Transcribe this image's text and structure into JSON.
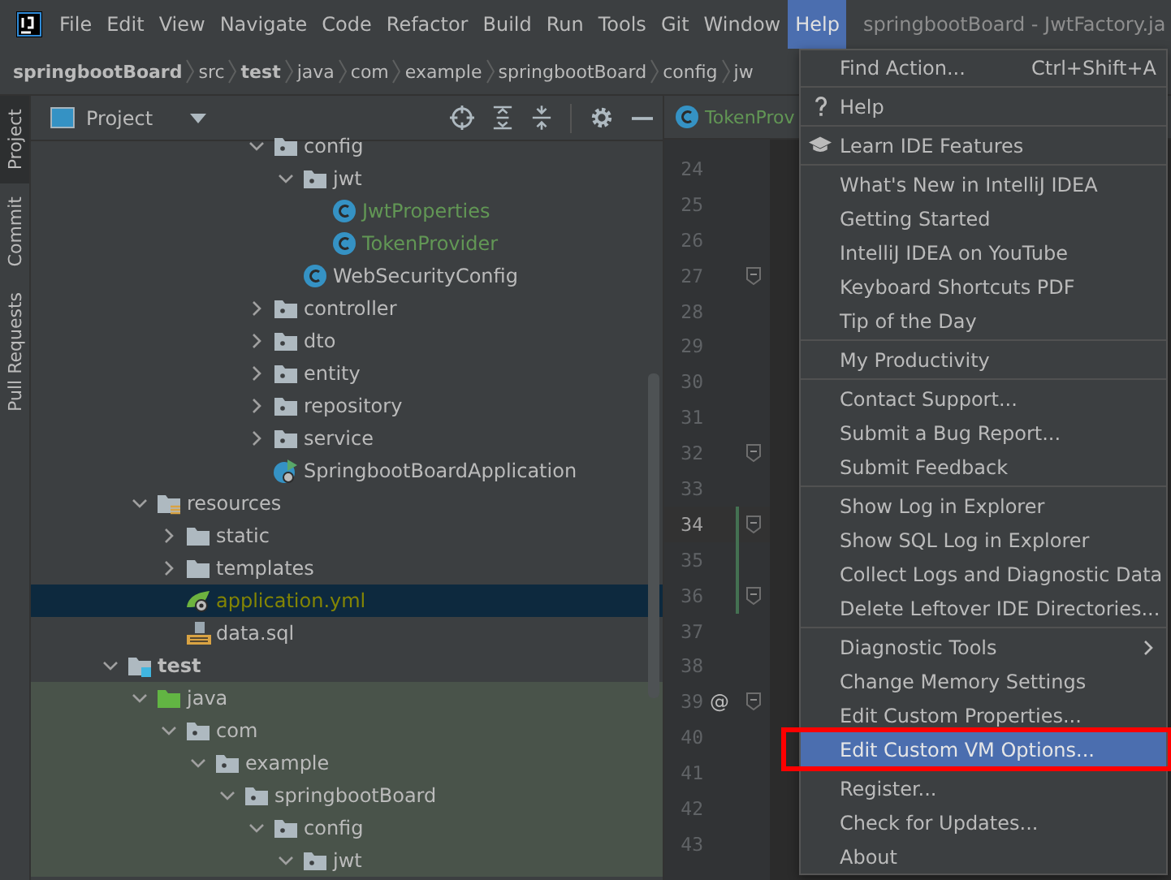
{
  "menu_bar": {
    "items": [
      {
        "label": "File",
        "selected": false
      },
      {
        "label": "Edit",
        "selected": false
      },
      {
        "label": "View",
        "selected": false
      },
      {
        "label": "Navigate",
        "selected": false
      },
      {
        "label": "Code",
        "selected": false
      },
      {
        "label": "Refactor",
        "selected": false
      },
      {
        "label": "Build",
        "selected": false
      },
      {
        "label": "Run",
        "selected": false
      },
      {
        "label": "Tools",
        "selected": false
      },
      {
        "label": "Git",
        "selected": false
      },
      {
        "label": "Window",
        "selected": false
      },
      {
        "label": "Help",
        "selected": true
      }
    ],
    "title": "springbootBoard - JwtFactory.ja"
  },
  "breadcrumbs": [
    {
      "label": "springbootBoard",
      "bold": true
    },
    {
      "label": "src",
      "bold": false
    },
    {
      "label": "test",
      "bold": true
    },
    {
      "label": "java",
      "bold": false
    },
    {
      "label": "com",
      "bold": false
    },
    {
      "label": "example",
      "bold": false
    },
    {
      "label": "springbootBoard",
      "bold": false
    },
    {
      "label": "config",
      "bold": false
    },
    {
      "label": "jw",
      "bold": false
    }
  ],
  "side_tabs": [
    {
      "label": "Project",
      "selected": true
    },
    {
      "label": "Commit",
      "selected": false
    },
    {
      "label": "Pull Requests",
      "selected": false
    }
  ],
  "project_panel": {
    "title": "Project"
  },
  "tree": {
    "package_tail": [
      {
        "label": "config",
        "kind": "package",
        "expanded": true,
        "selected": false,
        "color": "#bbbbbb",
        "children": [
          {
            "label": "jwt",
            "kind": "package",
            "expanded": true,
            "selected": false,
            "color": "#bbbbbb",
            "children": [
              {
                "label": "JwtProperties",
                "kind": "class",
                "selected": false,
                "color": "#629755"
              },
              {
                "label": "TokenProvider",
                "kind": "class",
                "selected": false,
                "color": "#629755"
              }
            ]
          },
          {
            "label": "WebSecurityConfig",
            "kind": "class",
            "selected": false,
            "color": "#bbbbbb"
          }
        ]
      },
      {
        "label": "controller",
        "kind": "package",
        "expanded": false,
        "selected": false,
        "color": "#bbbbbb"
      },
      {
        "label": "dto",
        "kind": "package",
        "expanded": false,
        "selected": false,
        "color": "#bbbbbb"
      },
      {
        "label": "entity",
        "kind": "package",
        "expanded": false,
        "selected": false,
        "color": "#bbbbbb"
      },
      {
        "label": "repository",
        "kind": "package",
        "expanded": false,
        "selected": false,
        "color": "#bbbbbb"
      },
      {
        "label": "service",
        "kind": "package",
        "expanded": false,
        "selected": false,
        "color": "#bbbbbb"
      },
      {
        "label": "SpringbootBoardApplication",
        "kind": "spring_app",
        "selected": false,
        "color": "#bbbbbb"
      }
    ],
    "resources": [
      {
        "label": "resources",
        "kind": "resources_root",
        "expanded": true,
        "selected": false,
        "color": "#bbbbbb",
        "children": [
          {
            "label": "static",
            "kind": "folder",
            "expanded": false,
            "selected": false,
            "color": "#bbbbbb"
          },
          {
            "label": "templates",
            "kind": "folder",
            "expanded": false,
            "selected": false,
            "color": "#bbbbbb"
          },
          {
            "label": "application.yml",
            "kind": "yaml",
            "selected": true,
            "color": "#848504"
          },
          {
            "label": "data.sql",
            "kind": "sql",
            "selected": false,
            "color": "#bbbbbb"
          }
        ]
      }
    ],
    "test": [
      {
        "label": "test",
        "kind": "test_root",
        "expanded": true,
        "selected": false,
        "color": "#bbbbbb",
        "children": [
          {
            "label": "java",
            "kind": "test_sources",
            "expanded": true,
            "selected": false,
            "color": "#bbbbbb",
            "children": [
              {
                "label": "com",
                "kind": "package",
                "expanded": true,
                "selected": false,
                "color": "#bbbbbb",
                "children": [
                  {
                    "label": "example",
                    "kind": "package",
                    "expanded": true,
                    "selected": false,
                    "color": "#bbbbbb",
                    "children": [
                      {
                        "label": "springbootBoard",
                        "kind": "package",
                        "expanded": true,
                        "selected": false,
                        "color": "#bbbbbb",
                        "children": [
                          {
                            "label": "config",
                            "kind": "package",
                            "expanded": true,
                            "selected": false,
                            "color": "#bbbbbb",
                            "children": [
                              {
                                "label": "jwt",
                                "kind": "package",
                                "expanded": true,
                                "selected": false,
                                "color": "#bbbbbb"
                              }
                            ]
                          }
                        ]
                      }
                    ]
                  }
                ]
              }
            ]
          }
        ]
      }
    ]
  },
  "editor": {
    "tab": {
      "label": "TokenProv",
      "color": "#629755"
    },
    "lines": [
      {
        "number": "24",
        "fold": false,
        "current": false,
        "changed": false
      },
      {
        "number": "25",
        "fold": false,
        "current": false,
        "changed": false
      },
      {
        "number": "26",
        "fold": false,
        "current": false,
        "changed": false
      },
      {
        "number": "27",
        "fold": true,
        "current": false,
        "changed": false
      },
      {
        "number": "28",
        "fold": false,
        "current": false,
        "changed": false
      },
      {
        "number": "29",
        "fold": false,
        "current": false,
        "changed": false
      },
      {
        "number": "30",
        "fold": false,
        "current": false,
        "changed": false
      },
      {
        "number": "31",
        "fold": false,
        "current": false,
        "changed": false
      },
      {
        "number": "32",
        "fold": true,
        "current": false,
        "changed": false
      },
      {
        "number": "33",
        "fold": false,
        "current": false,
        "changed": false
      },
      {
        "number": "34",
        "fold": true,
        "current": true,
        "changed": true
      },
      {
        "number": "35",
        "fold": false,
        "current": false,
        "changed": true
      },
      {
        "number": "36",
        "fold": true,
        "current": false,
        "changed": true
      },
      {
        "number": "37",
        "fold": false,
        "current": false,
        "changed": false
      },
      {
        "number": "38",
        "fold": false,
        "current": false,
        "changed": false
      },
      {
        "number": "39",
        "fold": true,
        "current": false,
        "changed": false,
        "marker": "@"
      },
      {
        "number": "40",
        "fold": false,
        "current": false,
        "changed": false
      },
      {
        "number": "41",
        "fold": false,
        "current": false,
        "changed": false
      },
      {
        "number": "42",
        "fold": false,
        "current": false,
        "changed": false
      },
      {
        "number": "43",
        "fold": false,
        "current": false,
        "changed": false
      }
    ]
  },
  "help_menu": {
    "sections": [
      [
        {
          "label": "Find Action...",
          "shortcut": "Ctrl+Shift+A",
          "kind": "action",
          "selected": false,
          "boxed": false
        }
      ],
      [
        {
          "label": "Help",
          "kind": "help",
          "selected": false,
          "boxed": false
        }
      ],
      [
        {
          "label": "Learn IDE Features",
          "kind": "learn",
          "selected": false,
          "boxed": false
        }
      ],
      [
        {
          "label": "What's New in IntelliJ IDEA",
          "kind": "action",
          "selected": false,
          "boxed": false
        },
        {
          "label": "Getting Started",
          "kind": "action",
          "selected": false,
          "boxed": false
        },
        {
          "label": "IntelliJ IDEA on YouTube",
          "kind": "action",
          "selected": false,
          "boxed": false
        },
        {
          "label": "Keyboard Shortcuts PDF",
          "kind": "action",
          "selected": false,
          "boxed": false
        },
        {
          "label": "Tip of the Day",
          "kind": "action",
          "selected": false,
          "boxed": false
        }
      ],
      [
        {
          "label": "My Productivity",
          "kind": "action",
          "selected": false,
          "boxed": false
        }
      ],
      [
        {
          "label": "Contact Support...",
          "kind": "action",
          "selected": false,
          "boxed": false
        },
        {
          "label": "Submit a Bug Report...",
          "kind": "action",
          "selected": false,
          "boxed": false
        },
        {
          "label": "Submit Feedback",
          "kind": "action",
          "selected": false,
          "boxed": false
        }
      ],
      [
        {
          "label": "Show Log in Explorer",
          "kind": "action",
          "selected": false,
          "boxed": false
        },
        {
          "label": "Show SQL Log in Explorer",
          "kind": "action",
          "selected": false,
          "boxed": false
        },
        {
          "label": "Collect Logs and Diagnostic Data",
          "kind": "action",
          "selected": false,
          "boxed": false
        },
        {
          "label": "Delete Leftover IDE Directories...",
          "kind": "action",
          "selected": false,
          "boxed": false
        }
      ],
      [
        {
          "label": "Diagnostic Tools",
          "kind": "submenu",
          "selected": false,
          "boxed": false
        },
        {
          "label": "Change Memory Settings",
          "kind": "action",
          "selected": false,
          "boxed": false
        },
        {
          "label": "Edit Custom Properties...",
          "kind": "action",
          "selected": false,
          "boxed": false
        },
        {
          "label": "Edit Custom VM Options...",
          "kind": "action",
          "selected": true,
          "boxed": true
        }
      ],
      [
        {
          "label": "Register...",
          "kind": "action",
          "selected": false,
          "boxed": false
        },
        {
          "label": "Check for Updates...",
          "kind": "action",
          "selected": false,
          "boxed": false
        },
        {
          "label": "About",
          "kind": "action",
          "selected": false,
          "boxed": false
        }
      ]
    ]
  }
}
